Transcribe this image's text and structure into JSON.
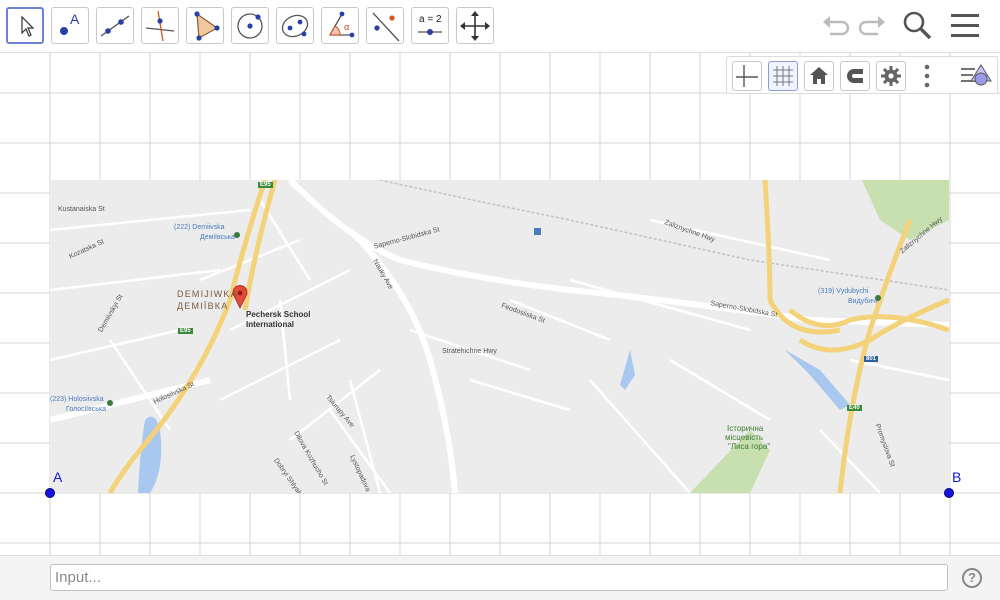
{
  "toolbar": {
    "tools": [
      {
        "name": "move-tool",
        "label": ""
      },
      {
        "name": "point-tool",
        "label": "A"
      },
      {
        "name": "line-tool",
        "label": ""
      },
      {
        "name": "perpendicular-line-tool",
        "label": ""
      },
      {
        "name": "polygon-tool",
        "label": ""
      },
      {
        "name": "circle-center-point-tool",
        "label": ""
      },
      {
        "name": "ellipse-tool",
        "label": ""
      },
      {
        "name": "angle-tool",
        "label": "α"
      },
      {
        "name": "reflect-about-line-tool",
        "label": ""
      },
      {
        "name": "slider-tool",
        "label": "a = 2"
      },
      {
        "name": "move-graphics-view-tool",
        "label": ""
      }
    ],
    "active_tool": "move-tool",
    "right": [
      "undo-icon",
      "redo-icon",
      "search-icon",
      "menu-icon"
    ]
  },
  "style_bar": {
    "buttons": [
      "axes-icon",
      "grid-icon",
      "home-icon",
      "magnet-icon",
      "gear-icon",
      "more-vertical-icon"
    ],
    "toggle": "view-toggle-icon"
  },
  "map": {
    "labels": {
      "kustanaiska": "Kustanaiska St",
      "demiivska_station": "(222) Demiivska",
      "demiivska_uk": "Деміївська",
      "kozatska": "Kozatska St",
      "demiivskyi": "Demiivskyi St",
      "district_en": "DEMIJIWKA",
      "district_uk": "ДЕМІЇВКА",
      "poi_line1": "Pechersk School",
      "poi_line2": "International",
      "e95_top": "E95",
      "e95_mid": "E95",
      "sapero_top": "Saperno-Slobidska St",
      "sapero_right": "Saperno-Slobidska St",
      "naukyi": "Nauky Ave",
      "zaliznychne": "Zaliznychne Hwy",
      "feodosiiska": "Feodosiiska St",
      "stratehichne": "Stratehichne Hwy",
      "holosiivska": "Holosiivska St",
      "holosiivska_station": "(223) Holosiivska",
      "holosiivska_uk": "Голосіївська",
      "vydubychi": "(319) Vydubychi",
      "vydubychi_uk": "Видубичі",
      "tsyurupy": "Tsiurupy Ave",
      "dilova": "Dilova Kozhucho St",
      "dobryi": "Dobryi Shlyakh",
      "lystopadova": "Lystopadova",
      "hist_line1": "Історична",
      "hist_line2": "місцевість",
      "hist_line3": "\"Лиса гора\"",
      "e40": "E40",
      "route_801": "801",
      "promyslova": "Promyslova St",
      "zaliznychne_right": "Zaliznychne Hwy"
    }
  },
  "points": {
    "a": "A",
    "b": "B"
  },
  "input": {
    "placeholder": "Input...",
    "value": ""
  },
  "help": {
    "label": "?"
  },
  "colors": {
    "point": "#1515e0",
    "active_tool_border": "#6d82d6",
    "highway": "#f4d27a"
  }
}
